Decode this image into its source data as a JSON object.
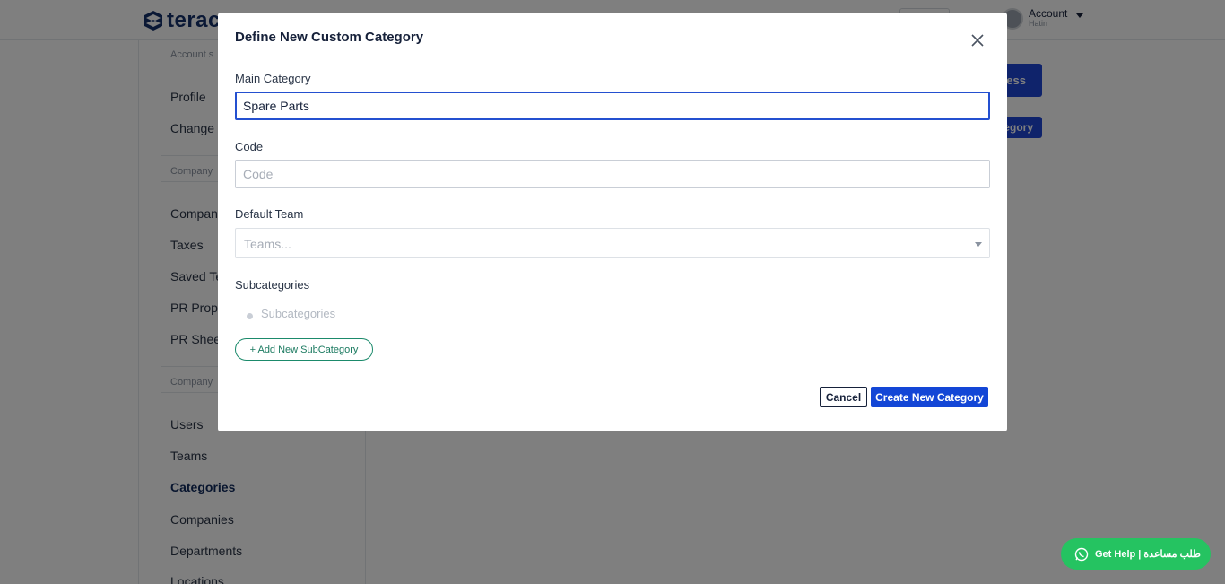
{
  "header": {
    "logo_text": "terac",
    "account_label": "Account",
    "account_sub": "Hatin"
  },
  "sidebar": {
    "sections": [
      "Account s",
      "Company",
      "Company"
    ],
    "items": [
      {
        "label": "Profile"
      },
      {
        "label": "Change P"
      },
      {
        "label": "Company"
      },
      {
        "label": "Taxes"
      },
      {
        "label": "Saved Te"
      },
      {
        "label": "PR Prope"
      },
      {
        "label": "PR Sheet"
      },
      {
        "label": "Users"
      },
      {
        "label": "Teams"
      },
      {
        "label": "Categories",
        "active": true
      },
      {
        "label": "Companies"
      },
      {
        "label": "Departments"
      },
      {
        "label": "Locations"
      }
    ]
  },
  "background_buttons": {
    "primary_label": "ess",
    "secondary_label": "tegory"
  },
  "modal": {
    "title": "Define New Custom Category",
    "main_category": {
      "label": "Main Category",
      "value": "Spare Parts"
    },
    "code": {
      "label": "Code",
      "placeholder": "Code",
      "value": ""
    },
    "default_team": {
      "label": "Default Team",
      "placeholder": "Teams..."
    },
    "subcategories": {
      "label": "Subcategories",
      "empty_text": "Subcategories"
    },
    "add_subcategory_label": "+ Add New SubCategory",
    "cancel_label": "Cancel",
    "create_label": "Create New Category"
  },
  "help": {
    "label": "Get Help | طلب مساعدة"
  },
  "colors": {
    "brand_navy": "#15306b",
    "primary_blue": "#1346d6",
    "success_green": "#25c361",
    "outline_green": "#1b8a6b"
  },
  "icons": {
    "close": "close-icon",
    "whatsapp": "whatsapp-icon",
    "caret": "caret-down-icon"
  }
}
